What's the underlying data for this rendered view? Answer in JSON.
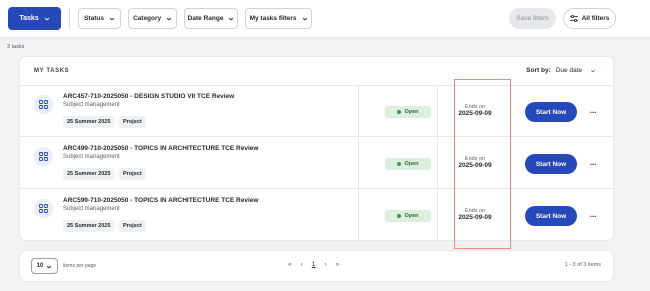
{
  "toolbar": {
    "tasks_label": "Tasks",
    "filters": [
      {
        "label": "Status"
      },
      {
        "label": "Category"
      },
      {
        "label": "Date Range"
      },
      {
        "label": "My tasks filters"
      }
    ],
    "save_filters_label": "Save filters",
    "all_filters_label": "All filters"
  },
  "task_count": "3 tasks",
  "card": {
    "title": "MY TASKS",
    "sort_label": "Sort by:",
    "sort_value": "Due date"
  },
  "tasks": [
    {
      "title": "ARC457-710-2025050 - DESIGN STUDIO VII TCE Review",
      "subtitle": "Subject management",
      "tags": [
        "25 Summer 2025",
        "Project"
      ],
      "status": "Open",
      "ends_label": "Ends on",
      "ends_date": "2025-09-09",
      "action": "Start Now",
      "more": "···"
    },
    {
      "title": "ARC499-710-2025050 - TOPICS IN ARCHITECTURE TCE Review",
      "subtitle": "Subject management",
      "tags": [
        "25 Summer 2025",
        "Project"
      ],
      "status": "Open",
      "ends_label": "Ends on",
      "ends_date": "2025-09-09",
      "action": "Start Now",
      "more": "···"
    },
    {
      "title": "ARC599-710-2025050 - TOPICS IN ARCHITECTURE TCE Review",
      "subtitle": "Subject management",
      "tags": [
        "25 Summer 2025",
        "Project"
      ],
      "status": "Open",
      "ends_label": "Ends on",
      "ends_date": "2025-09-09",
      "action": "Start Now",
      "more": "···"
    }
  ],
  "pagination": {
    "per_page": "10",
    "per_page_label": "items per page",
    "first": "«",
    "prev": "‹",
    "current_page": "1",
    "next": "›",
    "last": "»",
    "range": "1 - 3 of 3 items"
  },
  "colors": {
    "primary": "#2748b8",
    "open_badge_bg": "#dcefdf",
    "open_dot": "#3e9b4f",
    "highlight_box": "#f1887a"
  },
  "icons": {
    "chevron": "chevron-down-icon",
    "all_filters": "sliders-icon",
    "task": "grid-icon",
    "more": "more-horizontal-icon"
  }
}
